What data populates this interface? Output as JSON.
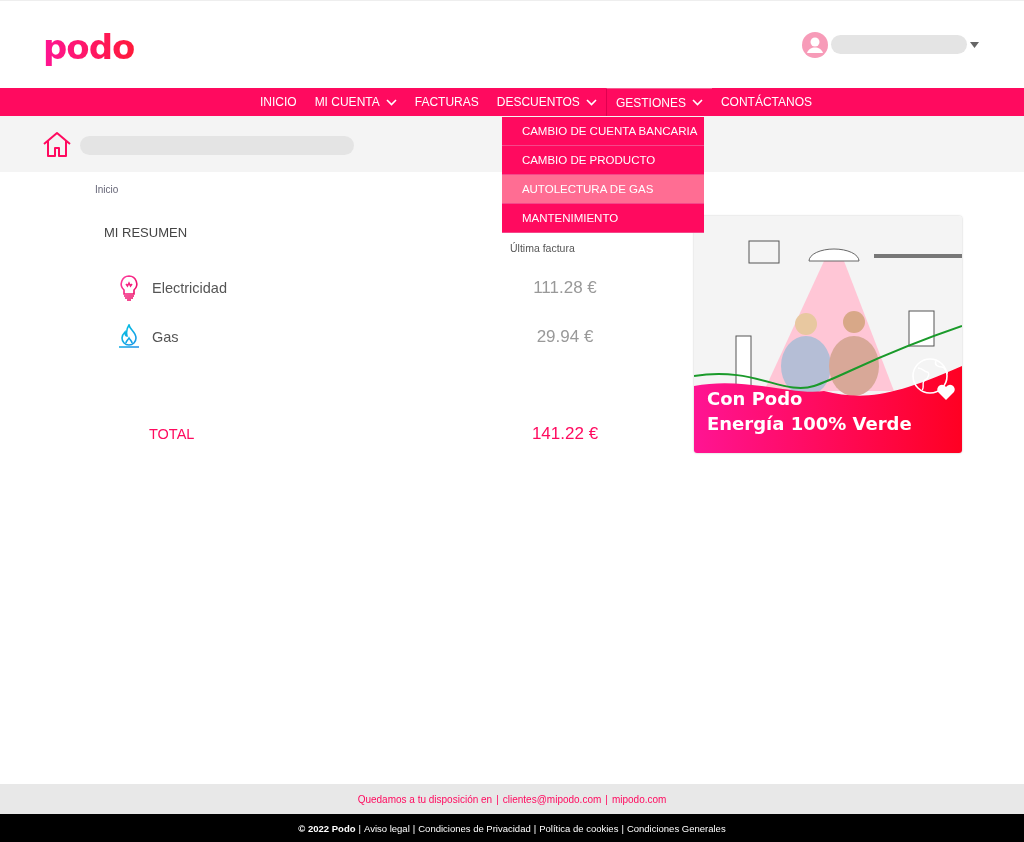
{
  "header": {
    "logo": "podo"
  },
  "nav": {
    "items": [
      {
        "label": "INICIO",
        "has_menu": false,
        "open": false
      },
      {
        "label": "MI CUENTA",
        "has_menu": true,
        "open": false
      },
      {
        "label": "FACTURAS",
        "has_menu": false,
        "open": false
      },
      {
        "label": "DESCUENTOS",
        "has_menu": true,
        "open": false
      },
      {
        "label": "GESTIONES",
        "has_menu": true,
        "open": true
      },
      {
        "label": "CONTÁCTANOS",
        "has_menu": false,
        "open": false
      }
    ],
    "dropdown": [
      {
        "label": "CAMBIO DE CUENTA BANCARIA",
        "selected": false
      },
      {
        "label": "CAMBIO DE PRODUCTO",
        "selected": false
      },
      {
        "label": "AUTOLECTURA DE GAS",
        "selected": true
      },
      {
        "label": "MANTENIMIENTO",
        "selected": false
      }
    ]
  },
  "breadcrumb": "Inicio",
  "summary": {
    "title": "MI RESUMEN",
    "column_label": "Última factura",
    "rows": [
      {
        "kind": "electricity",
        "label": "Electricidad",
        "amount": "111.28 €"
      },
      {
        "kind": "gas",
        "label": "Gas",
        "amount": "29.94 €"
      }
    ],
    "total": {
      "label": "TOTAL",
      "amount": "141.22 €"
    }
  },
  "banner": {
    "kind": "picture",
    "lines": [
      "Con Podo",
      "Energía 100% Verde"
    ]
  },
  "footer": {
    "contact": {
      "intro": "Quedamos a tu disposición en",
      "separator": "|",
      "links": [
        "clientes@mipodo.com",
        "mipodo.com"
      ]
    },
    "legal": {
      "copyright": "© 2022 Podo",
      "separator": "|",
      "links": [
        "Aviso legal",
        "Condiciones de Privacidad",
        "Política de cookies",
        "Condiciones Generales"
      ]
    }
  }
}
